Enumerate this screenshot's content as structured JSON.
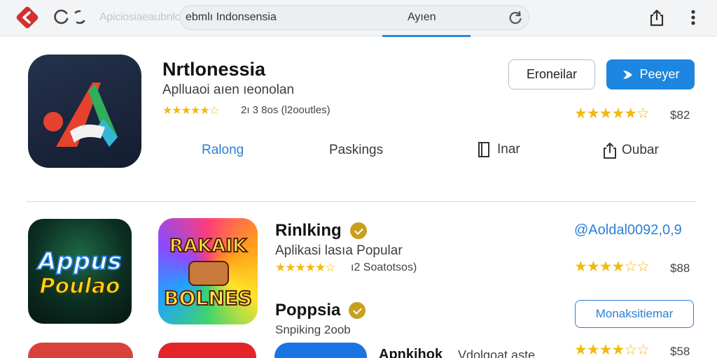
{
  "browser": {
    "url_ghost": "Apiciosiaeaubnloi",
    "url_text": "ebmlı Indonsensia",
    "url_center": "Ayıen"
  },
  "featured": {
    "title": "Nrtlonessia",
    "subtitle": "Aplluaoi aıen ıeonolan",
    "rating_text": "2ı 3 8os (l2ooutles)",
    "btn_secondary": "Eroneilar",
    "btn_primary": "Peeyer",
    "price": "$82",
    "links": [
      "Ralong",
      "Paskings",
      "Inar",
      "Oubar"
    ],
    "stars": 4.5
  },
  "apps": [
    {
      "tile_text_1": "Appus",
      "tile_text_2": "Poulao",
      "title": "Rinlking",
      "subtitle": "Aplikasi lasıa Popular",
      "rating_count": "ı2 Soatotsos)",
      "link": "@Aoldal0092,0,9",
      "price": "$88",
      "stars": 4.5
    },
    {
      "tile_text_1": "RAKAIK",
      "tile_text_2": "BOLNES",
      "title": "Poppsia",
      "subtitle": "Snpiking 2oob",
      "button": "Monaksitiemar",
      "price": "$58",
      "stars": 4
    },
    {
      "title": "Apnkihok",
      "subtitle": "Vdolgoat aste"
    }
  ],
  "colors": {
    "accent": "#1c86e0",
    "link": "#2a7fd6",
    "star": "#f2b90e",
    "back": "#d32f2f"
  }
}
